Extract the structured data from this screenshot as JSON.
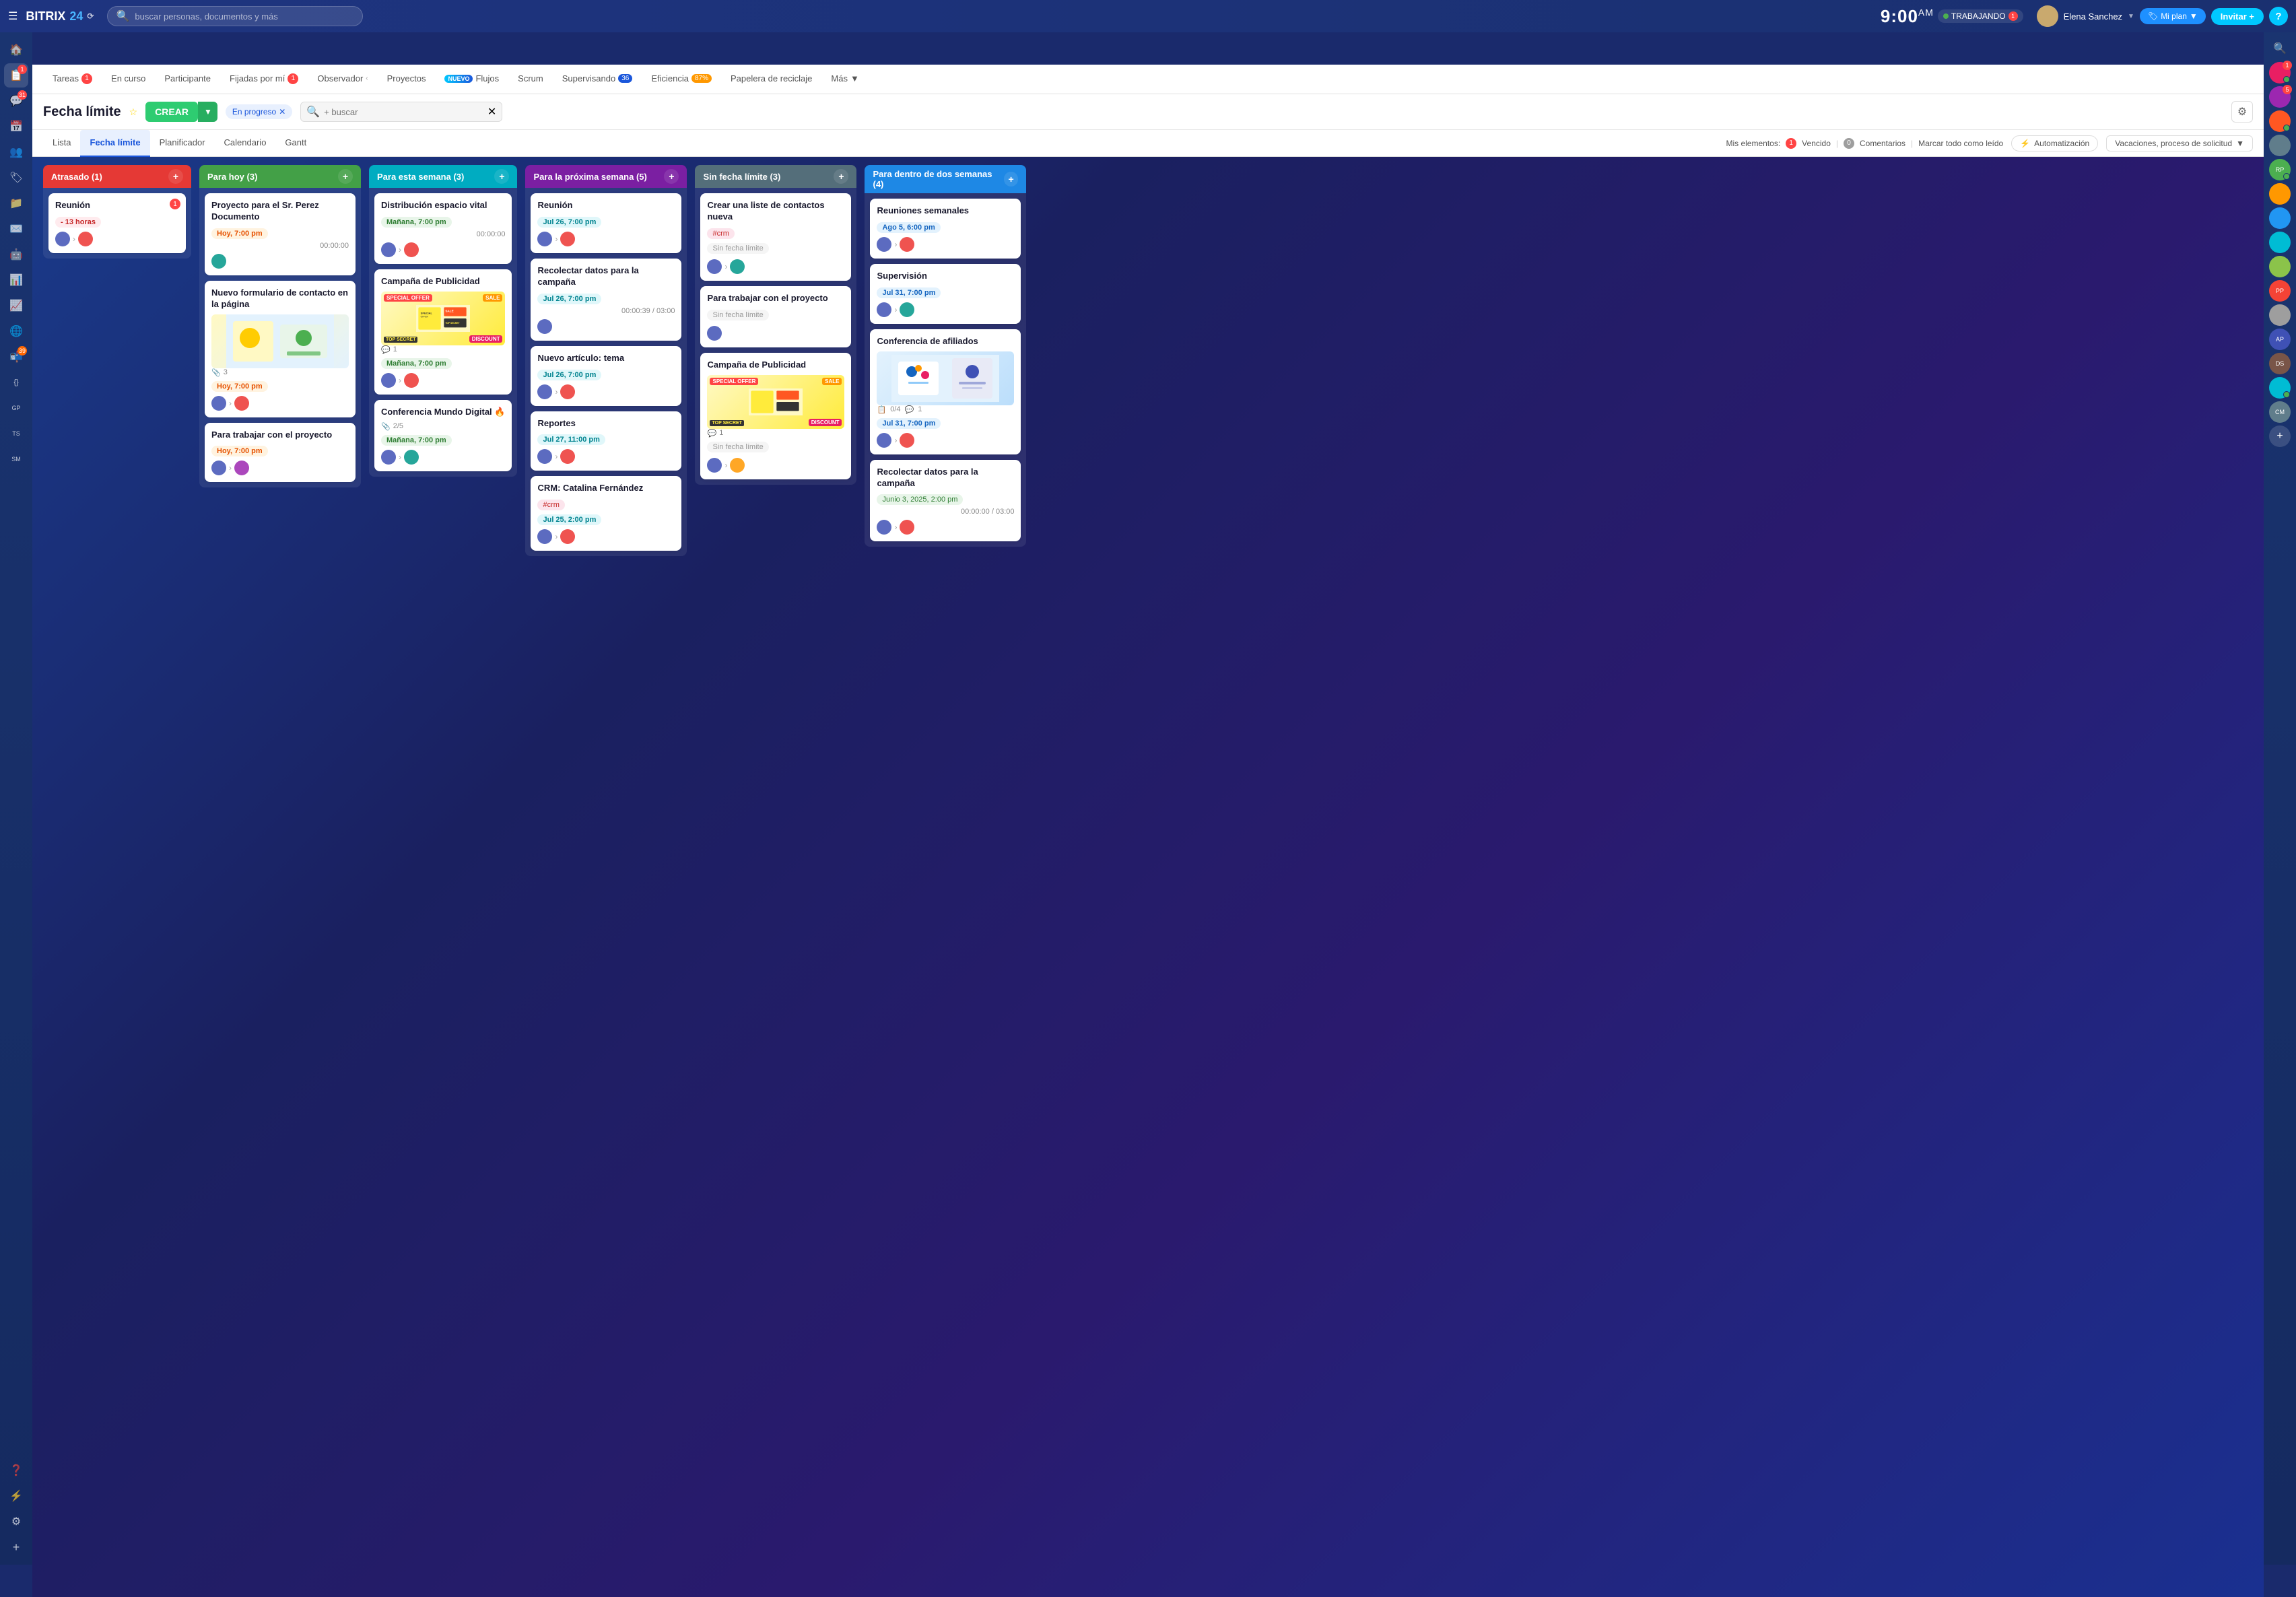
{
  "app": {
    "name": "BITRIX",
    "num": "24"
  },
  "navbar": {
    "search_placeholder": "buscar personas, documentos y más",
    "time": "9:00",
    "time_suffix": "AM",
    "status": "TRABAJANDO",
    "status_count": "1",
    "user_name": "Elena Sanchez",
    "btn_miplan": "Mi plan",
    "btn_invitar": "Invitar",
    "btn_help": "?"
  },
  "tabs": [
    {
      "label": "Tareas",
      "badge": "1",
      "active": false
    },
    {
      "label": "En curso",
      "badge": null,
      "active": false
    },
    {
      "label": "Participante",
      "badge": null,
      "active": false
    },
    {
      "label": "Fijadas por mí",
      "badge": "1",
      "active": false
    },
    {
      "label": "Observador",
      "badge": null,
      "active": false
    },
    {
      "label": "Proyectos",
      "badge": null,
      "active": false
    },
    {
      "label": "Flujos",
      "badge": null,
      "nuevo": true,
      "active": false
    },
    {
      "label": "Scrum",
      "badge": null,
      "active": false
    },
    {
      "label": "Supervisando",
      "badge": "36",
      "active": false
    },
    {
      "label": "Eficiencia",
      "badge": "87%",
      "active": false
    },
    {
      "label": "Papelera de reciclaje",
      "badge": null,
      "active": false
    },
    {
      "label": "Más",
      "badge": null,
      "active": false
    }
  ],
  "page": {
    "title": "Fecha límite",
    "btn_crear": "CREAR",
    "filter_label": "En progreso",
    "search_placeholder": "+ buscar"
  },
  "subtabs": [
    {
      "label": "Lista"
    },
    {
      "label": "Fecha límite",
      "active": true
    },
    {
      "label": "Planificador"
    },
    {
      "label": "Calendario"
    },
    {
      "label": "Gantt"
    }
  ],
  "filters": {
    "mis_elementos": "Mis elementos:",
    "vencido_count": "1",
    "vencido_label": "Vencido",
    "comentarios_count": "0",
    "comentarios_label": "Comentarios",
    "marcar": "Marcar todo como leído",
    "automatizacion": "Automatización",
    "vacaciones": "Vacaciones, proceso de solicitud"
  },
  "columns": [
    {
      "id": "atrasado",
      "header": "Atrasado (1)",
      "color": "red",
      "cards": [
        {
          "title": "Reunión",
          "badge": "1",
          "time_tag": "- 13 horas",
          "time_color": "red",
          "avatars": [
            "a1",
            "a2"
          ]
        }
      ]
    },
    {
      "id": "para_hoy",
      "header": "Para hoy (3)",
      "color": "green",
      "cards": [
        {
          "title": "Proyecto para el Sr. Perez Documento",
          "time_tag": "Hoy, 7:00 pm",
          "time_color": "orange",
          "timer": "00:00:00",
          "avatars": [
            "a3"
          ]
        },
        {
          "title": "Nuevo formulario de contacto en la página",
          "has_image": true,
          "image_type": "illustration",
          "counter": "3",
          "time_tag": "Hoy, 7:00 pm",
          "time_color": "orange",
          "avatars": [
            "a1",
            "a2"
          ]
        },
        {
          "title": "Para trabajar con el proyecto",
          "time_tag": "Hoy, 7:00 pm",
          "time_color": "orange",
          "avatars": [
            "a1",
            "a4"
          ]
        }
      ]
    },
    {
      "id": "para_esta_semana",
      "header": "Para esta semana (3)",
      "color": "cyan",
      "cards": [
        {
          "title": "Distribución espacio vital",
          "time_tag": "Mañana, 7:00 pm",
          "time_color": "green-tag",
          "timer": "00:00:00",
          "avatars": [
            "a1",
            "a2"
          ]
        },
        {
          "title": "Campaña de Publicidad",
          "has_image": true,
          "image_type": "ad",
          "icon_count": "1",
          "time_tag": "Mañana, 7:00 pm",
          "time_color": "green-tag",
          "avatars": [
            "a1",
            "a2"
          ]
        },
        {
          "title": "Conferencia Mundo Digital 🔥",
          "icon_row": "2/5",
          "time_tag": "Mañana, 7:00 pm",
          "time_color": "green-tag",
          "avatars": [
            "a1",
            "a3"
          ]
        }
      ]
    },
    {
      "id": "para_proxima_semana",
      "header": "Para la próxima semana (5)",
      "color": "purple",
      "cards": [
        {
          "title": "Reunión",
          "time_tag": "Jul 26, 7:00 pm",
          "time_color": "cyan-tag",
          "avatars": [
            "a1",
            "a2"
          ]
        },
        {
          "title": "Recolectar datos para la campaña",
          "time_tag": "Jul 26, 7:00 pm",
          "time_color": "cyan-tag",
          "timer": "00:00:39 / 03:00",
          "avatars": [
            "a1"
          ]
        },
        {
          "title": "Nuevo artículo: tema",
          "time_tag": "Jul 26, 7:00 pm",
          "time_color": "cyan-tag",
          "avatars": [
            "a1",
            "a2"
          ]
        },
        {
          "title": "Reportes",
          "time_tag": "Jul 27, 11:00 pm",
          "time_color": "cyan-tag",
          "avatars": [
            "a1",
            "a2"
          ]
        },
        {
          "title": "CRM: Catalina Fernández",
          "tag": "#crm",
          "time_tag": "Jul 25, 2:00 pm",
          "time_color": "cyan-tag",
          "avatars": [
            "a1",
            "a2"
          ]
        }
      ]
    },
    {
      "id": "sin_fecha",
      "header": "Sin fecha límite (3)",
      "color": "gray",
      "cards": [
        {
          "title": "Crear una liste de contactos nueva",
          "tag": "#crm",
          "no_date": "Sin fecha límite",
          "avatars": [
            "a1",
            "a3"
          ]
        },
        {
          "title": "Para trabajar con el proyecto",
          "no_date": "Sin fecha límite",
          "avatars": [
            "a1"
          ]
        },
        {
          "title": "Campaña de Publicidad",
          "has_image": true,
          "image_type": "ad",
          "icon_count": "1",
          "no_date": "Sin fecha límite",
          "avatars": [
            "a1",
            "a5"
          ]
        }
      ]
    },
    {
      "id": "para_dos_semanas",
      "header": "Para dentro de dos semanas (4)",
      "color": "blue",
      "cards": [
        {
          "title": "Reuniones semanales",
          "time_tag": "Ago 5, 6:00 pm",
          "time_color": "blue-tag",
          "avatars": [
            "a1",
            "a2"
          ]
        },
        {
          "title": "Supervisión",
          "time_tag": "Jul 31, 7:00 pm",
          "time_color": "blue-tag",
          "avatars": [
            "a1",
            "a3"
          ]
        },
        {
          "title": "Conferencia de afiliados",
          "has_image": true,
          "image_type": "conference",
          "progress": "0/4",
          "icon_count": "1",
          "time_tag": "Jul 31, 7:00 pm",
          "time_color": "blue-tag",
          "avatars": [
            "a1",
            "a2"
          ]
        },
        {
          "title": "Recolectar datos para la campaña",
          "time_tag": "Junio 3, 2025, 2:00 pm",
          "time_color": "date",
          "timer": "00:00:00 / 03:00",
          "avatars": [
            "a1",
            "a2"
          ]
        }
      ]
    }
  ],
  "sidebar_items": [
    {
      "icon": "☰",
      "name": "menu"
    },
    {
      "icon": "🏠",
      "name": "home"
    },
    {
      "icon": "📋",
      "name": "tasks",
      "badge": "1"
    },
    {
      "icon": "💬",
      "name": "chat",
      "badge": "31"
    },
    {
      "icon": "📅",
      "name": "calendar"
    },
    {
      "icon": "👥",
      "name": "contacts"
    },
    {
      "icon": "🏷",
      "name": "crm"
    },
    {
      "icon": "📁",
      "name": "drive"
    },
    {
      "icon": "✉️",
      "name": "mail"
    },
    {
      "icon": "🔔",
      "name": "notifications"
    },
    {
      "icon": "⚙",
      "name": "automation"
    },
    {
      "icon": "📊",
      "name": "analytics"
    },
    {
      "icon": "📈",
      "name": "reports"
    },
    {
      "icon": "📝",
      "name": "sites"
    },
    {
      "icon": "🤖",
      "name": "robot"
    },
    {
      "icon": "📦",
      "name": "inbox",
      "badge": "39"
    },
    {
      "icon": "{ }",
      "name": "code"
    },
    {
      "text": "GP",
      "name": "gp"
    },
    {
      "text": "TS",
      "name": "ts"
    },
    {
      "text": "SM",
      "name": "sm"
    },
    {
      "icon": "⊕",
      "name": "add"
    }
  ],
  "right_avatars": [
    {
      "initials": "🔍",
      "name": "search"
    },
    {
      "color": "#e91e63",
      "initials": "1",
      "online": true,
      "badge": "1"
    },
    {
      "color": "#9c27b0",
      "initials": "5",
      "online": true,
      "badge": "5"
    },
    {
      "color": "#ff5722",
      "initials": "",
      "online": false
    },
    {
      "color": "#607d8b",
      "initials": "",
      "online": false
    },
    {
      "color": "#4caf50",
      "initials": "RP",
      "online": true
    },
    {
      "color": "#ff9800",
      "initials": "",
      "online": false
    },
    {
      "color": "#2196f3",
      "initials": "",
      "online": false
    },
    {
      "color": "#00bcd4",
      "initials": "",
      "online": false
    },
    {
      "color": "#8bc34a",
      "initials": "",
      "online": false
    },
    {
      "color": "#f44336",
      "initials": "PP",
      "online": false
    },
    {
      "color": "#9e9e9e",
      "initials": "",
      "online": false
    },
    {
      "color": "#3f51b5",
      "initials": "AP",
      "online": false
    },
    {
      "color": "#795548",
      "initials": "DS",
      "online": false
    },
    {
      "color": "#00bcd4",
      "initials": "",
      "online": true
    },
    {
      "color": "#607d8b",
      "initials": "CM",
      "online": false
    }
  ]
}
